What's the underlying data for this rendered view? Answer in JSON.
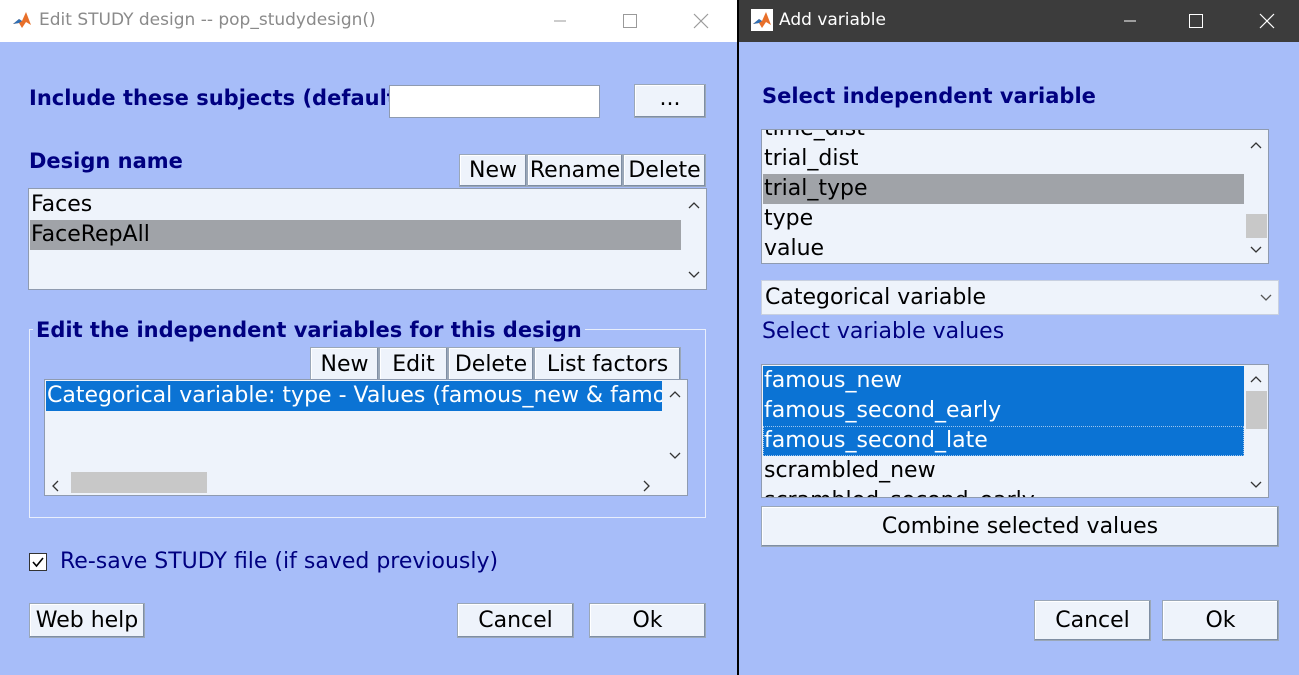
{
  "left_window": {
    "title": "Edit STUDY design -- pop_studydesign()",
    "include_label": "Include these subjects (default:",
    "include_value": "",
    "browse_button": "...",
    "design_name_label": "Design name",
    "design_buttons": [
      "New",
      "Rename",
      "Delete"
    ],
    "designs": [
      "Faces",
      "FaceRepAll"
    ],
    "selected_design": "FaceRepAll",
    "indep_group_title": "Edit the independent variables for this design",
    "indep_buttons": [
      "New",
      "Edit",
      "Delete",
      "List factors"
    ],
    "indep_items": [
      "Categorical variable: type - Values (famous_new & famous_second_early & famous_second_late)"
    ],
    "resave_label": "Re-save STUDY file (if saved previously)",
    "resave_checked": true,
    "web_help": "Web help",
    "cancel": "Cancel",
    "ok": "Ok"
  },
  "right_window": {
    "title": "Add variable",
    "select_var_label": "Select independent variable",
    "variables": [
      "time_dist",
      "trial_dist",
      "trial_type",
      "type",
      "value"
    ],
    "selected_variable": "trial_type",
    "variable_type": "Categorical variable",
    "select_values_label": "Select variable values",
    "values": [
      "famous_new",
      "famous_second_early",
      "famous_second_late",
      "scrambled_new",
      "scrambled_second_early"
    ],
    "selected_values": [
      "famous_new",
      "famous_second_early",
      "famous_second_late"
    ],
    "combine_button": "Combine selected values",
    "cancel": "Cancel",
    "ok": "Ok"
  },
  "colors": {
    "dialog_bg": "#a7bdf9",
    "label_navy": "#000080",
    "selection_blue": "#0b73d4",
    "selection_gray": "#a0a3a8",
    "active_titlebar": "#3c3c3c"
  },
  "icons": [
    "matlab-icon",
    "minimize-icon",
    "maximize-icon",
    "close-icon",
    "chevron-up-icon",
    "chevron-down-icon",
    "chevron-left-icon",
    "chevron-right-icon",
    "checkmark-icon"
  ]
}
